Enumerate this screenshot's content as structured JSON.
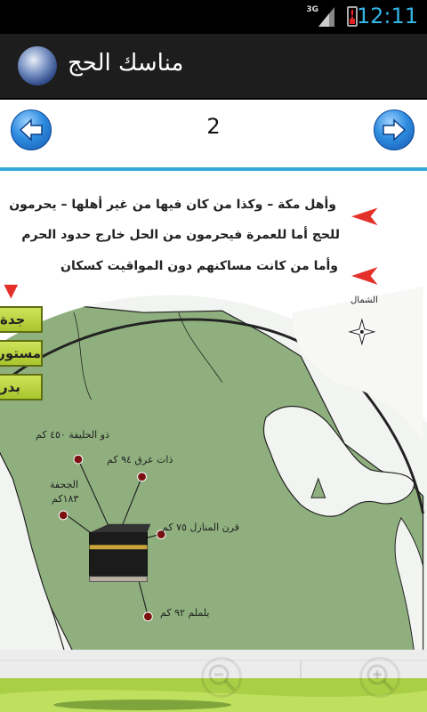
{
  "status_bar": {
    "network": "3G",
    "time": "12:11",
    "icons": [
      "signal-icon",
      "battery-alert-icon"
    ]
  },
  "action_bar": {
    "title": "مناسك الحج",
    "icon": "app-logo-icon"
  },
  "pager": {
    "page_number": "2",
    "prev_icon": "arrow-left-icon",
    "next_icon": "arrow-right-icon"
  },
  "content": {
    "lines": [
      "وأهل مكة – وكذا من كان فيها من غير أهلها – يحرمون",
      "للحج أما للعمرة فيحرمون من الحل خارج حدود الحرم",
      "وأما من كانت مساكنهم دون المواقيت كسكان"
    ],
    "north_label": "الشمال",
    "left_tabs": [
      "جدة",
      "مستورة",
      "بدر"
    ],
    "places": [
      "ذو الحليفة ٤٥٠ كم",
      "ذات عرق ٩٤ كم",
      "الجحفة",
      "١٨٣كم",
      "قرن المنازل ٧٥ كم",
      "يلملم ٩٢ كم"
    ]
  },
  "bottom_controls": {
    "zoom_out_icon": "zoom-out-icon",
    "zoom_in_icon": "zoom-in-icon"
  },
  "colors": {
    "accent": "#35a8d8",
    "status_time": "#33b5e5",
    "map_land": "#8fb07e",
    "map_sea": "#f4f6f3",
    "marker_red": "#e3312a",
    "tab_green": "#b9d33b"
  }
}
